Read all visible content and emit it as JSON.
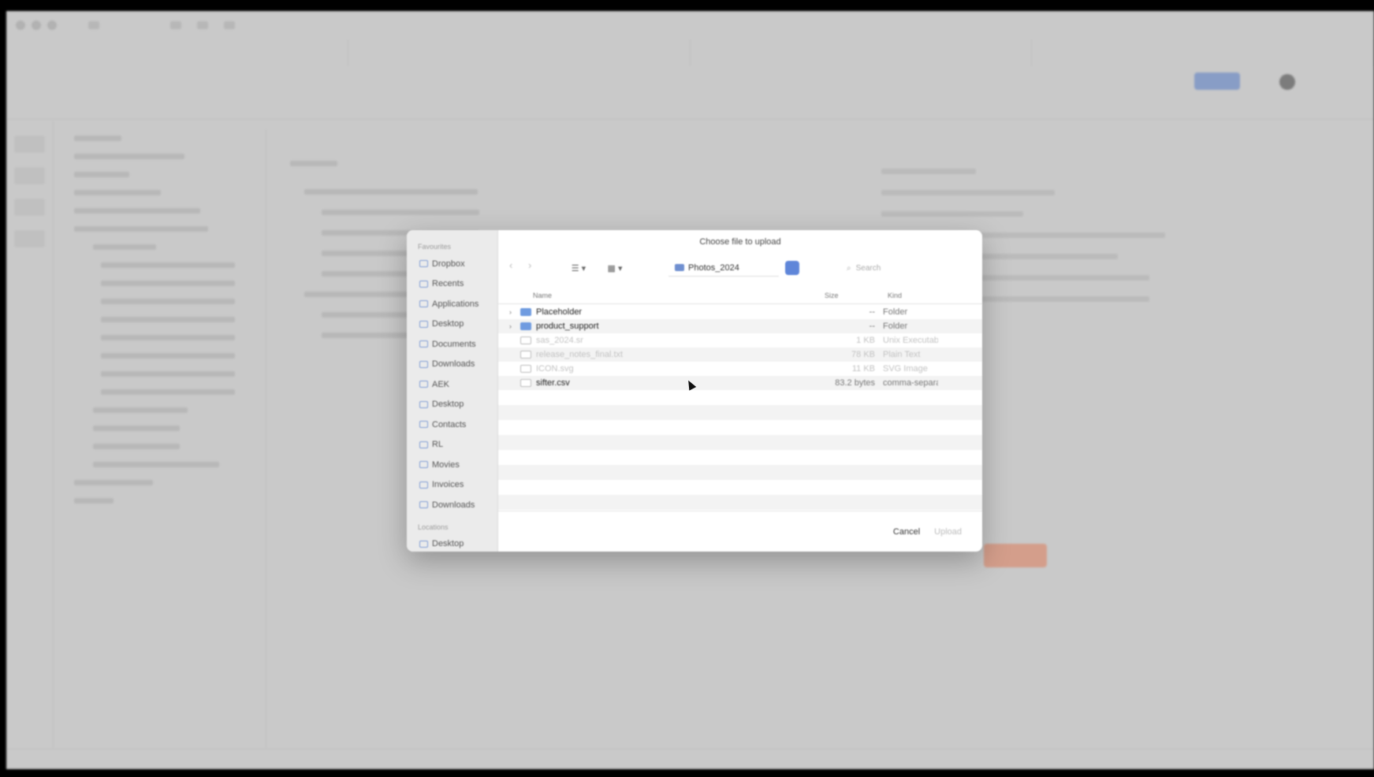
{
  "dialog": {
    "title": "Choose file to upload",
    "location": "Photos_2024",
    "search_placeholder": "Search",
    "columns": {
      "name": "Name",
      "size": "Size",
      "kind": "Kind"
    },
    "sidebar_header": "Favourites",
    "sidebar_items": [
      {
        "label": "Dropbox",
        "icon": "dropbox-icon"
      },
      {
        "label": "Recents",
        "icon": "clock-icon"
      },
      {
        "label": "Applications",
        "icon": "apps-icon"
      },
      {
        "label": "Desktop",
        "icon": "desktop-icon"
      },
      {
        "label": "Documents",
        "icon": "document-icon"
      },
      {
        "label": "Downloads",
        "icon": "download-icon"
      },
      {
        "label": "AEK",
        "icon": "folder-icon"
      },
      {
        "label": "Desktop",
        "icon": "folder-icon"
      },
      {
        "label": "Contacts",
        "icon": "folder-icon"
      },
      {
        "label": "RL",
        "icon": "folder-icon"
      },
      {
        "label": "Movies",
        "icon": "movie-icon"
      },
      {
        "label": "Invoices",
        "icon": "folder-icon"
      },
      {
        "label": "Downloads",
        "icon": "folder-icon"
      }
    ],
    "sidebar_footer_header": "Locations",
    "sidebar_footer_item": "Desktop",
    "files": [
      {
        "name": "Placeholder",
        "size": "--",
        "kind": "Folder",
        "type": "folder",
        "disabled": false
      },
      {
        "name": "product_support",
        "size": "--",
        "kind": "Folder",
        "type": "folder",
        "disabled": false
      },
      {
        "name": "sas_2024.sr",
        "size": "1 KB",
        "kind": "Unix Executable",
        "type": "file",
        "disabled": true
      },
      {
        "name": "release_notes_final.txt",
        "size": "78 KB",
        "kind": "Plain Text",
        "type": "file",
        "disabled": true
      },
      {
        "name": "ICON.svg",
        "size": "11 KB",
        "kind": "SVG Image",
        "type": "file",
        "disabled": true
      },
      {
        "name": "sifter.csv",
        "size": "83.2 bytes",
        "kind": "comma-separated",
        "type": "file",
        "disabled": false
      }
    ],
    "cancel_label": "Cancel",
    "open_label": "Upload"
  }
}
